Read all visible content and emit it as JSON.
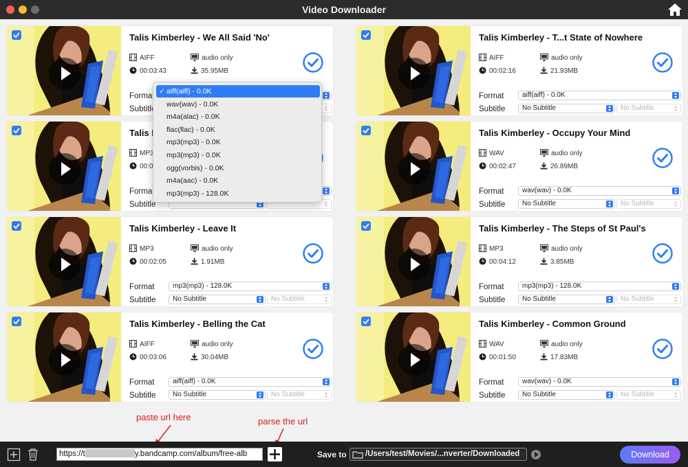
{
  "window": {
    "title": "Video Downloader"
  },
  "labels": {
    "format": "Format",
    "subtitle": "Subtitle"
  },
  "items": [
    {
      "title": "Talis Kimberley - We All Said 'No'",
      "type": "AIFF",
      "mode": "audio only",
      "duration": "00:03:43",
      "size": "35.95MB",
      "format": "aiff(aiff) - 0.0K",
      "subtitle": "No Subtitle",
      "subtitle2": "No Subtitle"
    },
    {
      "title": "Talis Kimberley - T...t State of Nowhere",
      "type": "AIFF",
      "mode": "audio only",
      "duration": "00:02:16",
      "size": "21.93MB",
      "format": "aiff(aiff) - 0.0K",
      "subtitle": "No Subtitle",
      "subtitle2": "No Subtitle"
    },
    {
      "title": "Talis K",
      "type": "MP3",
      "mode": "audio only",
      "duration": "00:0",
      "size": "",
      "format": "",
      "subtitle": "",
      "subtitle2": ""
    },
    {
      "title": "Talis Kimberley - Occupy Your Mind",
      "type": "WAV",
      "mode": "audio only",
      "duration": "00:02:47",
      "size": "26.89MB",
      "format": "wav(wav) - 0.0K",
      "subtitle": "No Subtitle",
      "subtitle2": "No Subtitle"
    },
    {
      "title": "Talis Kimberley - Leave It",
      "type": "MP3",
      "mode": "audio only",
      "duration": "00:02:05",
      "size": "1.91MB",
      "format": "mp3(mp3) - 128.0K",
      "subtitle": "No Subtitle",
      "subtitle2": "No Subtitle"
    },
    {
      "title": "Talis Kimberley - The Steps of St Paul's",
      "type": "MP3",
      "mode": "audio only",
      "duration": "00:04:12",
      "size": "3.85MB",
      "format": "mp3(mp3) - 128.0K",
      "subtitle": "No Subtitle",
      "subtitle2": "No Subtitle"
    },
    {
      "title": "Talis Kimberley - Belling the Cat",
      "type": "AIFF",
      "mode": "audio only",
      "duration": "00:03:06",
      "size": "30.04MB",
      "format": "aiff(aiff) - 0.0K",
      "subtitle": "No Subtitle",
      "subtitle2": "No Subtitle"
    },
    {
      "title": "Talis Kimberley - Common Ground",
      "type": "WAV",
      "mode": "audio only",
      "duration": "00:01:50",
      "size": "17.83MB",
      "format": "wav(wav) - 0.0K",
      "subtitle": "No Subtitle",
      "subtitle2": "No Subtitle"
    }
  ],
  "dropdown": {
    "options": [
      "aiff(aiff) - 0.0K",
      "wav(wav) - 0.0K",
      "m4a(alac) - 0.0K",
      "flac(flac) - 0.0K",
      "mp3(mp3) - 0.0K",
      "mp3(mp3) - 0.0K",
      "ogg(vorbis) - 0.0K",
      "m4a(aac) - 0.0K",
      "mp3(mp3) - 128.0K"
    ],
    "selected_index": 0
  },
  "annotations": {
    "paste": "paste url here",
    "parse": "parse the url"
  },
  "bottom": {
    "url_prefix": "https://t",
    "url_suffix": "y.bandcamp.com/album/free-alb",
    "save_to": "Save to",
    "path": "/Users/test/Movies/...nverter/Downloaded",
    "download": "Download"
  },
  "colors": {
    "accent": "#2f7df6",
    "titlebar": "#2c2c2c",
    "bottombar": "#1f1f1f"
  }
}
